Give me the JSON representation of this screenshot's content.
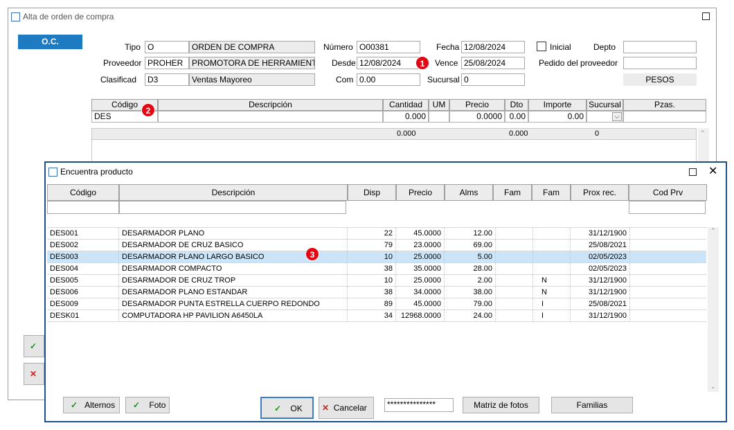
{
  "main_window": {
    "title": "Alta de orden de compra",
    "oc_tab": "O.C.",
    "fields": {
      "tipo_label": "Tipo",
      "tipo_value": "O",
      "tipo_desc": "ORDEN DE COMPRA",
      "proveedor_label": "Proveedor",
      "proveedor_value": "PROHER",
      "proveedor_desc": "PROMOTORA DE HERRAMIENTAS",
      "clasificad_label": "Clasificad",
      "clasificad_value": "D3",
      "clasificad_desc": "Ventas Mayoreo",
      "numero_label": "Número",
      "numero_value": "O00381",
      "desde_label": "Desde",
      "desde_value": "12/08/2024",
      "com_label": "Com",
      "com_value": "0.00",
      "fecha_label": "Fecha",
      "fecha_value": "12/08/2024",
      "vence_label": "Vence",
      "vence_value": "25/08/2024",
      "sucursal_label": "Sucursal",
      "sucursal_value": "0",
      "inicial_label": "Inicial",
      "depto_label": "Depto",
      "depto_value": "",
      "pedido_label": "Pedido del proveedor",
      "pedido_value": "",
      "currency": "PESOS"
    },
    "grid": {
      "headers": [
        "Código",
        "Descripción",
        "Cantidad",
        "UM",
        "Precio",
        "Dto",
        "Importe",
        "Sucursal",
        "Pzas."
      ],
      "entry_row": {
        "codigo": "DES",
        "cantidad": "0.000",
        "precio": "0.0000",
        "dto": "0.00",
        "importe": "0.00"
      },
      "totals": {
        "cantidad": "0.000",
        "dto": "0.000",
        "sucursal": "0"
      }
    }
  },
  "badges": [
    "1",
    "2",
    "3"
  ],
  "dialog": {
    "title": "Encuentra producto",
    "headers": [
      "Código",
      "Descripción",
      "Disp",
      "Precio",
      "Alms",
      "Fam",
      "Fam",
      "Prox rec.",
      "Cod Prv"
    ],
    "rows": [
      {
        "codigo": "DES001",
        "descripcion": "DESARMADOR PLANO",
        "disp": "22",
        "precio": "45.0000",
        "alms": "12.00",
        "fam1": "",
        "fam2": "",
        "prox": "31/12/1900"
      },
      {
        "codigo": "DES002",
        "descripcion": "DESARMADOR DE CRUZ BASICO",
        "disp": "79",
        "precio": "23.0000",
        "alms": "69.00",
        "fam1": "",
        "fam2": "",
        "prox": "25/08/2021"
      },
      {
        "codigo": "DES003",
        "descripcion": "DESARMADOR PLANO LARGO BASICO",
        "disp": "10",
        "precio": "25.0000",
        "alms": "5.00",
        "fam1": "",
        "fam2": "",
        "prox": "02/05/2023"
      },
      {
        "codigo": "DES004",
        "descripcion": "DESARMADOR COMPACTO",
        "disp": "38",
        "precio": "35.0000",
        "alms": "28.00",
        "fam1": "",
        "fam2": "",
        "prox": "02/05/2023"
      },
      {
        "codigo": "DES005",
        "descripcion": "DESARMADOR DE CRUZ TROP",
        "disp": "10",
        "precio": "25.0000",
        "alms": "2.00",
        "fam1": "",
        "fam2": "N",
        "prox": "31/12/1900"
      },
      {
        "codigo": "DES006",
        "descripcion": "DESARMADOR PLANO ESTANDAR",
        "disp": "38",
        "precio": "34.0000",
        "alms": "38.00",
        "fam1": "",
        "fam2": "N",
        "prox": "31/12/1900"
      },
      {
        "codigo": "DES009",
        "descripcion": "DESARMADOR PUNTA ESTRELLA CUERPO REDONDO",
        "disp": "89",
        "precio": "45.0000",
        "alms": "79.00",
        "fam1": "",
        "fam2": "I",
        "prox": "25/08/2021"
      },
      {
        "codigo": "DESK01",
        "descripcion": "COMPUTADORA HP PAVILION A6450LA",
        "disp": "34",
        "precio": "12968.0000",
        "alms": "24.00",
        "fam1": "",
        "fam2": "I",
        "prox": "31/12/1900"
      }
    ],
    "buttons": {
      "alternos": "Alternos",
      "foto": "Foto",
      "ok": "OK",
      "cancelar": "Cancelar",
      "password": "***************",
      "matriz": "Matriz de fotos",
      "familias": "Familias"
    }
  },
  "colors": {
    "accent": "#1f7bc1",
    "badge": "#e30613",
    "selected_row": "#cce4f7",
    "dialog_border": "#1e4e8c"
  }
}
